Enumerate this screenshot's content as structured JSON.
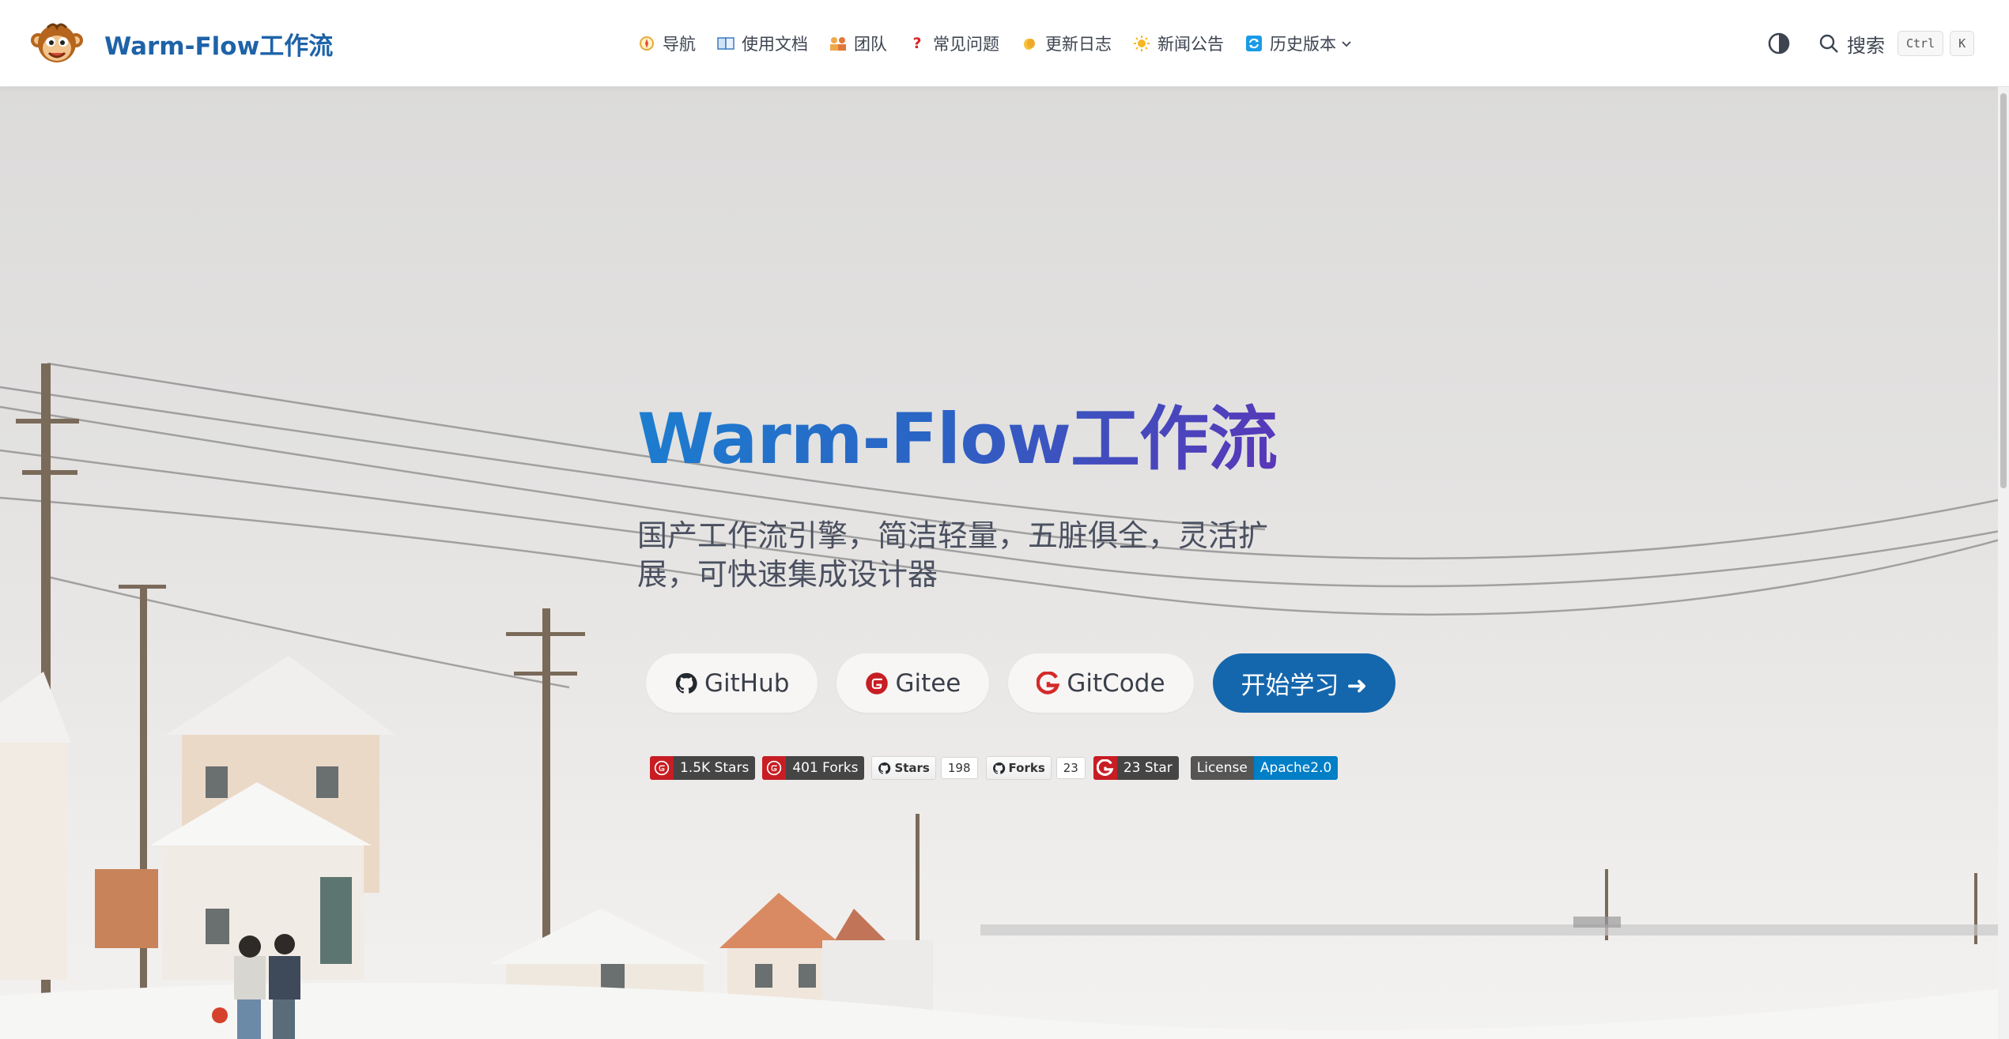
{
  "navbar": {
    "site_name": "Warm-Flow工作流",
    "items": [
      {
        "label": "导航",
        "icon": "compass-emoji-icon"
      },
      {
        "label": "使用文档",
        "icon": "book-emoji-icon"
      },
      {
        "label": "团队",
        "icon": "team-emoji-icon"
      },
      {
        "label": "常见问题",
        "icon": "question-mark-icon"
      },
      {
        "label": "更新日志",
        "icon": "clapping-hands-icon"
      },
      {
        "label": "新闻公告",
        "icon": "sun-icon"
      },
      {
        "label": "历史版本",
        "icon": "refresh-arrows-icon"
      }
    ],
    "search": {
      "label": "搜索",
      "key1": "Ctrl",
      "key2": "K"
    }
  },
  "hero": {
    "title": "Warm-Flow工作流",
    "tagline": "国产工作流引擎，简洁轻量，五脏俱全，灵活扩展，可快速集成设计器",
    "actions": {
      "github": "GitHub",
      "gitee": "Gitee",
      "gitcode": "GitCode",
      "start": "开始学习 ➜"
    }
  },
  "badges": {
    "gitee_stars": "1.5K Stars",
    "gitee_forks": "401 Forks",
    "gh_stars_label": "Stars",
    "gh_stars_count": "198",
    "gh_forks_label": "Forks",
    "gh_forks_count": "23",
    "gitcode_star": "23 Star",
    "license_key": "License",
    "license_value": "Apache2.0"
  },
  "colors": {
    "brand": "#1567ad",
    "title_gradient_start": "#1b7fd0",
    "title_gradient_end": "#5a35b8",
    "gitee_red": "#c71d23",
    "license_blue": "#007ec6"
  }
}
